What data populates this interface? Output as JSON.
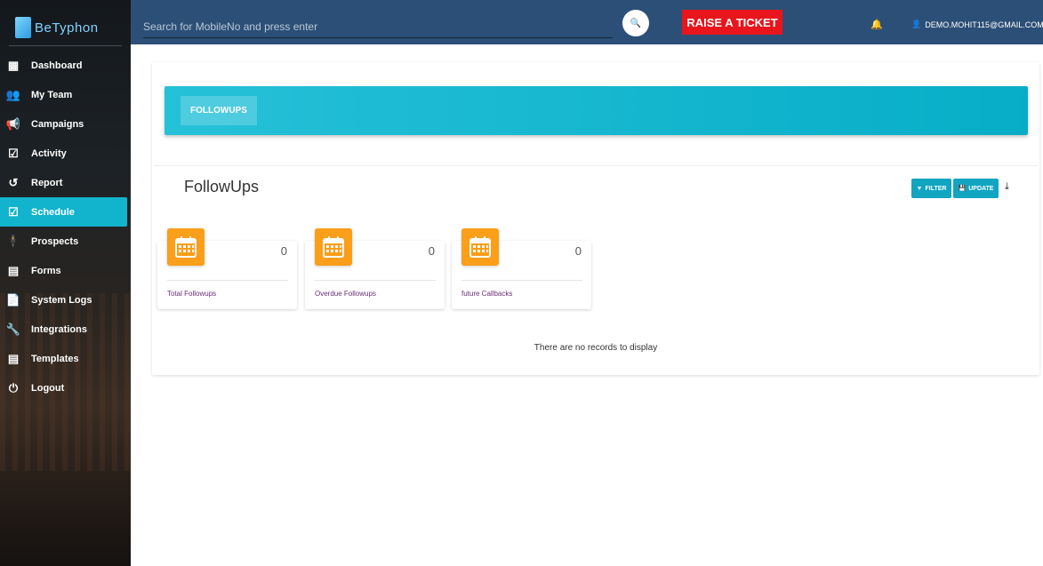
{
  "app": {
    "logo_text": "BeTyphon"
  },
  "sidebar": {
    "items": [
      {
        "label": "Dashboard",
        "icon": "dashboard-icon",
        "glyph": "▦"
      },
      {
        "label": "My Team",
        "icon": "team-icon",
        "glyph": "👥"
      },
      {
        "label": "Campaigns",
        "icon": "megaphone-icon",
        "glyph": "📢"
      },
      {
        "label": "Activity",
        "icon": "checklist-icon",
        "glyph": "☑"
      },
      {
        "label": "Report",
        "icon": "history-icon",
        "glyph": "↺"
      },
      {
        "label": "Schedule",
        "icon": "calendar-check-icon",
        "glyph": "☑",
        "active": true
      },
      {
        "label": "Prospects",
        "icon": "person-icon",
        "glyph": "🕴"
      },
      {
        "label": "Forms",
        "icon": "form-icon",
        "glyph": "▤"
      },
      {
        "label": "System Logs",
        "icon": "document-icon",
        "glyph": "📄"
      },
      {
        "label": "Integrations",
        "icon": "wrench-icon",
        "glyph": "🔧"
      },
      {
        "label": "Templates",
        "icon": "template-icon",
        "glyph": "▤"
      },
      {
        "label": "Logout",
        "icon": "power-icon",
        "glyph": "⏻"
      }
    ]
  },
  "header": {
    "search_placeholder": "Search for MobileNo and press enter",
    "search_icon_glyph": "🔍",
    "ticket_label": "RAISE A TICKET",
    "bell_glyph": "🔔",
    "user_glyph": "👤",
    "user_email": "DEMO.MOHIT115@GMAIL.COM"
  },
  "banner": {
    "tab_label": "FOLLOWUPS"
  },
  "main": {
    "title": "FollowUps",
    "filter_label": "FILTER",
    "update_label": "UPDATE",
    "filter_glyph": "▼",
    "update_glyph": "💾",
    "download_glyph": "⤓",
    "empty_message": "There are no records to display"
  },
  "stats": [
    {
      "label": "Total Followups",
      "value": "0"
    },
    {
      "label": "Overdue Followups",
      "value": "0"
    },
    {
      "label": "future Callbacks",
      "value": "0"
    }
  ],
  "colors": {
    "accent": "#12b3cd",
    "header": "#2c4f77",
    "ticket": "#e8151c",
    "stat_icon": "#fb9e1a",
    "stat_label": "#6a2e7a"
  }
}
